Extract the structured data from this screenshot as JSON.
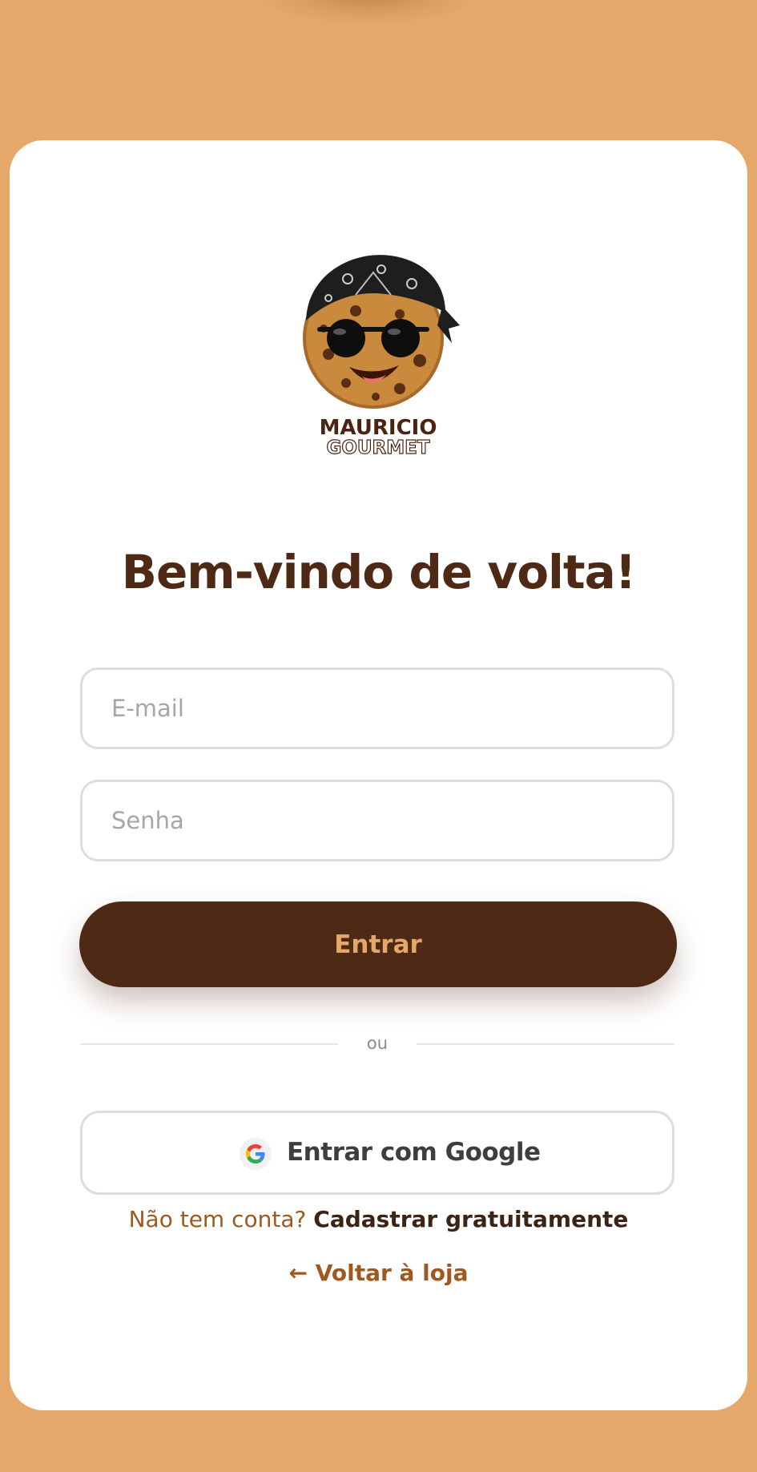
{
  "logo": {
    "line1": "MAURICIO",
    "line2": "GOURMET"
  },
  "title": "Bem-vindo de volta!",
  "form": {
    "email_placeholder": "E-mail",
    "password_placeholder": "Senha",
    "submit_label": "Entrar"
  },
  "divider": {
    "label": "ou"
  },
  "google": {
    "label": "Entrar com Google",
    "icon": "google-icon"
  },
  "signup": {
    "prompt": "Não tem conta?",
    "link": "Cadastrar gratuitamente"
  },
  "back": {
    "arrow": "←",
    "label": "Voltar à loja"
  },
  "colors": {
    "background": "#E6A76A",
    "card": "#FFFFFF",
    "primary": "#4E2A16",
    "accent": "#E6A76A",
    "link": "#A0581F"
  }
}
